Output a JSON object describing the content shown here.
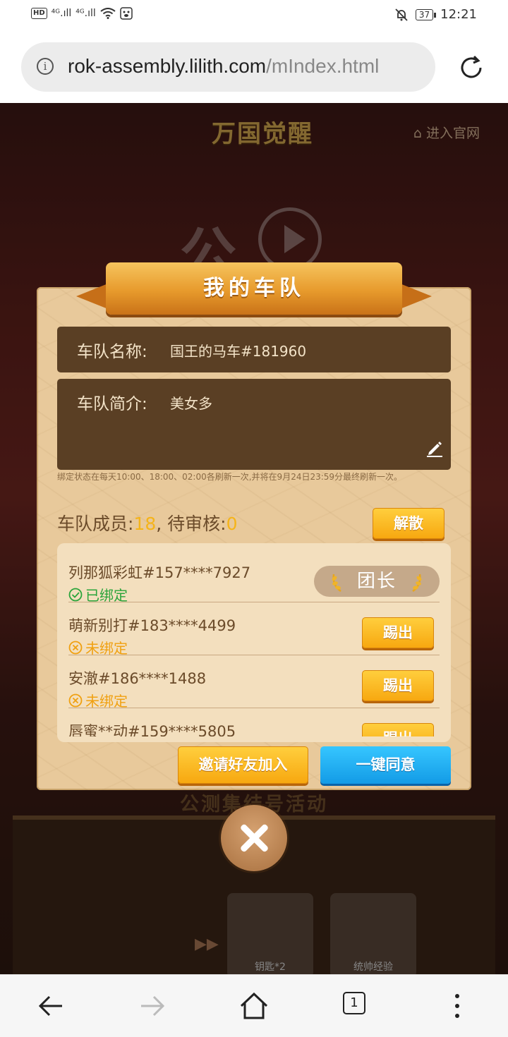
{
  "status_bar": {
    "hd_label": "HD",
    "signal_1": "⁴ᴳ.ıll",
    "signal_2": "⁴ᴳ.ıll",
    "battery": "37",
    "time": "12:21"
  },
  "browser": {
    "url_host": "rok-assembly.lilith.com",
    "url_path": "/mIndex.html",
    "tab_count": "1"
  },
  "background": {
    "logo": "万国觉醒",
    "official_link": "⌂ 进入官网",
    "deco_char": "公",
    "event_title": "公测集结号活动",
    "rewards": [
      {
        "label": "钥匙*2"
      },
      {
        "label": "统帅经验"
      }
    ]
  },
  "modal": {
    "title": "我的车队",
    "team_name_label": "车队名称:",
    "team_name_value": "国王的马车#181960",
    "team_intro_label": "车队简介:",
    "team_intro_value": "美女多",
    "notice": "绑定状态在每天10:00、18:00、02:00各刷新一次,并将在9月24日23:59分最终刷新一次。",
    "members_label": "车队成员:",
    "members_count": "18",
    "separator": ",",
    "pending_label": "待审核:",
    "pending_count": "0",
    "disband_label": "解散",
    "leader_label": "团长",
    "kick_label": "踢出",
    "members": [
      {
        "name": "列那狐彩虹#157****7927",
        "status": "已绑定",
        "bound": true,
        "is_leader": true
      },
      {
        "name": "萌新别打#183****4499",
        "status": "未绑定",
        "bound": false,
        "is_leader": false
      },
      {
        "name": "安澈#186****1488",
        "status": "未绑定",
        "bound": false,
        "is_leader": false
      },
      {
        "name": "唇蜜**动#159****5805",
        "status": "",
        "bound": false,
        "is_leader": false
      }
    ],
    "invite_label": "邀请好友加入",
    "approve_label": "一键同意"
  },
  "colors": {
    "accent_orange": "#f7a70f",
    "accent_blue": "#139be6",
    "bound_green": "#2aa43a",
    "unbound_orange": "#f0a010"
  }
}
